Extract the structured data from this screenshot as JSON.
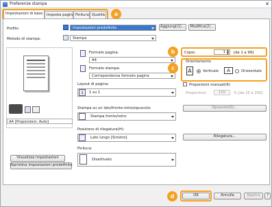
{
  "window": {
    "title": "Preferenze stampa"
  },
  "tabs": [
    {
      "label": "Impostazioni di base"
    },
    {
      "label": "Imposta pagina"
    },
    {
      "label": "Finitura"
    },
    {
      "label": "Qualità"
    }
  ],
  "callouts": {
    "a": "a",
    "b": "b",
    "c": "c"
  },
  "profile": {
    "label": "Profilo:",
    "value": "Impostazioni predefinite",
    "add_button": "Aggiungi(1)...",
    "edit_button": "Modifica(2)..."
  },
  "output_method": {
    "label": "Metodo di stampa:",
    "value": "Stampa"
  },
  "preview": {
    "caption": "A4 [Proporzioni: Auto]",
    "view_button": "Visualizza impostazioni",
    "restore_button": "Ripristina impostazioni predefinite"
  },
  "page_size": {
    "label": "Formato pagina:",
    "value": "A4"
  },
  "output_size": {
    "label": "Formato stampa:",
    "value": "Corrispondenza formato pagina"
  },
  "copies": {
    "label": "Copie:",
    "value": "1",
    "range": "[da 1 a 99]"
  },
  "orientation": {
    "label": "Orientamento",
    "portrait": "Verticale",
    "landscape": "Orizzontale",
    "selected": "portrait"
  },
  "page_layout": {
    "label": "Layout di pagina:",
    "value": "1 su 1"
  },
  "manual_scaling": {
    "label": "Proporzioni manuali(K)",
    "field_label": "Proporzioni:",
    "value": "100",
    "range": "% [da 25 a 200]",
    "checked": false
  },
  "duplex": {
    "label": "Stampa su un lato/fronte-retro/opuscolo:",
    "value": "Stampa fronte/retro",
    "booklet_button": "Opuscolo(G)..."
  },
  "binding": {
    "label": "Posizione di rilegatura(H):",
    "value": "Lato lungo [Sinistro]",
    "binding_button": "Rilegatura..."
  },
  "finishing": {
    "label": "Finitura:",
    "value": "Disattivato"
  },
  "footer": {
    "ok": "OK",
    "cancel": "Annulla",
    "apply": "Applica",
    "help": "?"
  }
}
